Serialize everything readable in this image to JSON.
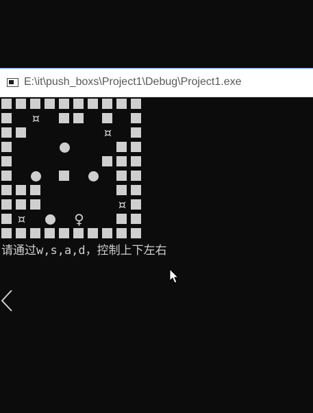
{
  "window": {
    "title": "E:\\it\\push_boxs\\Project1\\Debug\\Project1.exe",
    "icon": "console-app-icon"
  },
  "legend": {
    "wall": "■",
    "box": "●",
    "target": "¤",
    "player": "♀"
  },
  "board": [
    "##########",
    "#.T.##.#.#",
    "##.....T.#",
    "#...B...##",
    "#......###",
    "#.B.#.B.##",
    "###.....##",
    "###.....T#",
    "#T.B.P..##",
    "##########"
  ],
  "console": {
    "instruction": "请通过w,s,a,d，控制上下左右"
  },
  "colors": {
    "background": "#0c0c0c",
    "foreground": "#cfcfcf",
    "titlebar": "#ffffff",
    "title_text": "#585858"
  }
}
